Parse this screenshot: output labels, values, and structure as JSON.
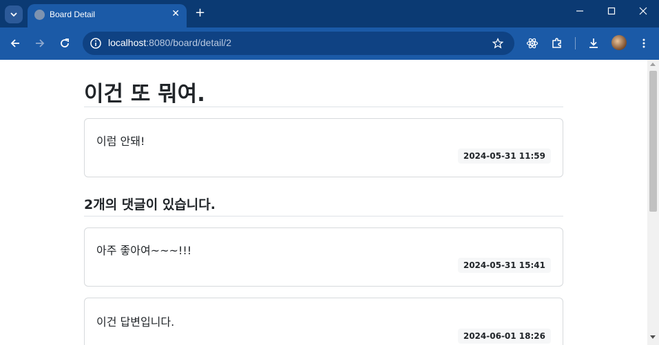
{
  "browser": {
    "tab_title": "Board Detail",
    "tab_close": "✕",
    "new_tab": "+",
    "url_host": "localhost",
    "url_path": ":8080/board/detail/2"
  },
  "board": {
    "title": "이건 또 뭐여.",
    "content": "이럼 안돼!",
    "date": "2024-05-31 11:59"
  },
  "comments_heading": "2개의 댓글이 있습니다.",
  "comments": [
    {
      "text": "아주 좋아여~~~!!!",
      "date": "2024-05-31 15:41"
    },
    {
      "text": "이건 답변입니다.",
      "date": "2024-06-01 18:26"
    }
  ]
}
